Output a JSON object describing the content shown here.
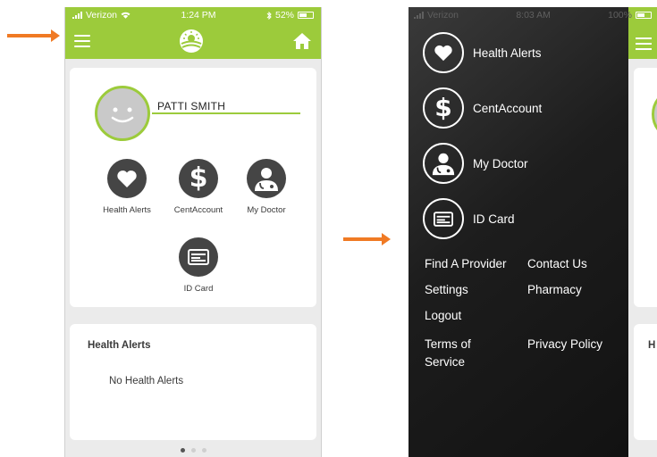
{
  "phone1": {
    "status": {
      "carrier": "Verizon",
      "time": "1:24 PM",
      "battery": "52%"
    },
    "user": {
      "name": "PATTI SMITH"
    },
    "tiles": [
      {
        "label": "Health Alerts",
        "icon": "heart-icon"
      },
      {
        "label": "CentAccount",
        "icon": "dollar-icon"
      },
      {
        "label": "My Doctor",
        "icon": "doctor-icon"
      },
      {
        "label": "ID Card",
        "icon": "id-card-icon"
      }
    ],
    "alerts": {
      "title": "Health Alerts",
      "empty": "No Health Alerts"
    },
    "pager": {
      "total": 3,
      "active": 1
    }
  },
  "phone2": {
    "status": {
      "carrier": "Verizon",
      "time": "8:03 AM",
      "battery": "100%"
    },
    "menu_items": [
      {
        "label": "Health Alerts",
        "icon": "heart-icon"
      },
      {
        "label": "CentAccount",
        "icon": "dollar-icon"
      },
      {
        "label": "My Doctor",
        "icon": "doctor-icon"
      },
      {
        "label": "ID Card",
        "icon": "id-card-icon"
      }
    ],
    "links": {
      "find_provider": "Find A Provider",
      "contact_us": "Contact Us",
      "settings": "Settings",
      "pharmacy": "Pharmacy",
      "logout": "Logout",
      "terms": "Terms of Service",
      "privacy": "Privacy Policy"
    },
    "peek_heading": "H"
  },
  "colors": {
    "accent": "#9ccb3b",
    "arrow": "#f07a24",
    "icon_dark": "#454545"
  }
}
